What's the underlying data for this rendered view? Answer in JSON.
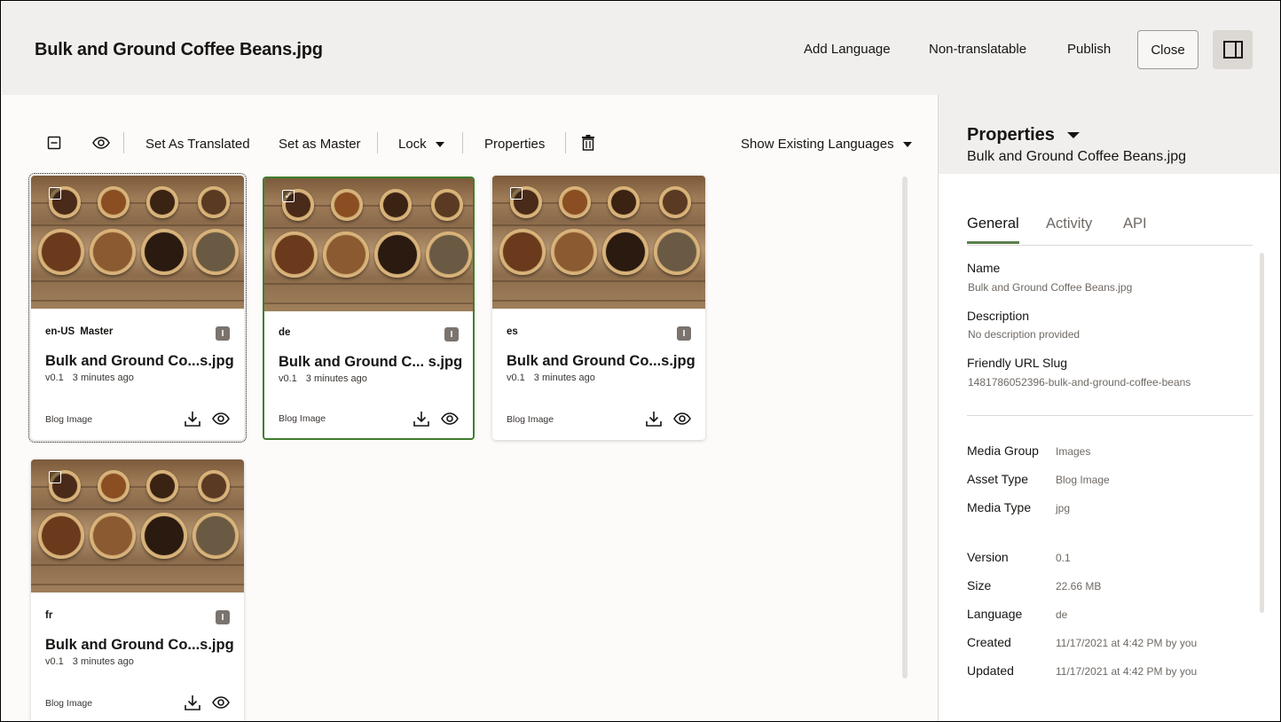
{
  "header": {
    "title": "Bulk and Ground Coffee Beans.jpg",
    "add_language": "Add Language",
    "non_translatable": "Non-translatable",
    "publish": "Publish",
    "close": "Close"
  },
  "toolbar": {
    "set_as_translated": "Set As Translated",
    "set_as_master": "Set as Master",
    "lock": "Lock",
    "properties": "Properties",
    "show_existing_languages": "Show Existing Languages"
  },
  "cards": [
    {
      "lang": "en-US",
      "master": "Master",
      "title": "Bulk and Ground Co...s.jpg",
      "version": "v0.1",
      "ago": "3 minutes ago",
      "type": "Blog Image",
      "info": "I",
      "checked": false
    },
    {
      "lang": "de",
      "master": "",
      "title": "Bulk and Ground C...  s.jpg",
      "version": "v0.1",
      "ago": "3 minutes ago",
      "type": "Blog Image",
      "info": "I",
      "checked": true
    },
    {
      "lang": "es",
      "master": "",
      "title": "Bulk and Ground Co...s.jpg",
      "version": "v0.1",
      "ago": "3 minutes ago",
      "type": "Blog Image",
      "info": "I",
      "checked": false
    },
    {
      "lang": "fr",
      "master": "",
      "title": "Bulk and Ground Co...s.jpg",
      "version": "v0.1",
      "ago": "3 minutes ago",
      "type": "Blog Image",
      "info": "I",
      "checked": false
    }
  ],
  "panel": {
    "title": "Properties",
    "subtitle": "Bulk and Ground Coffee Beans.jpg",
    "tabs": [
      "General",
      "Activity",
      "API"
    ],
    "name_label": "Name",
    "name_value": "Bulk and Ground Coffee Beans.jpg",
    "description_label": "Description",
    "description_value": "No description provided",
    "slug_label": "Friendly URL Slug",
    "slug_value": "1481786052396-bulk-and-ground-coffee-beans",
    "media_group_label": "Media Group",
    "media_group_value": "Images",
    "asset_type_label": "Asset Type",
    "asset_type_value": "Blog Image",
    "media_type_label": "Media Type",
    "media_type_value": "jpg",
    "version_label": "Version",
    "version_value": "0.1",
    "size_label": "Size",
    "size_value": "22.66 MB",
    "language_label": "Language",
    "language_value": "de",
    "created_label": "Created",
    "created_value": "11/17/2021 at 4:42 PM by you",
    "updated_label": "Updated",
    "updated_value": "11/17/2021 at 4:42 PM by you"
  },
  "colors": {
    "accent_green": "#3f7d2b",
    "header_bg": "#f1efed"
  },
  "icons": [
    "collapse-icon",
    "eye-icon",
    "trash-icon",
    "panel-toggle-icon",
    "download-icon",
    "info-icon",
    "checkbox-icon"
  ]
}
